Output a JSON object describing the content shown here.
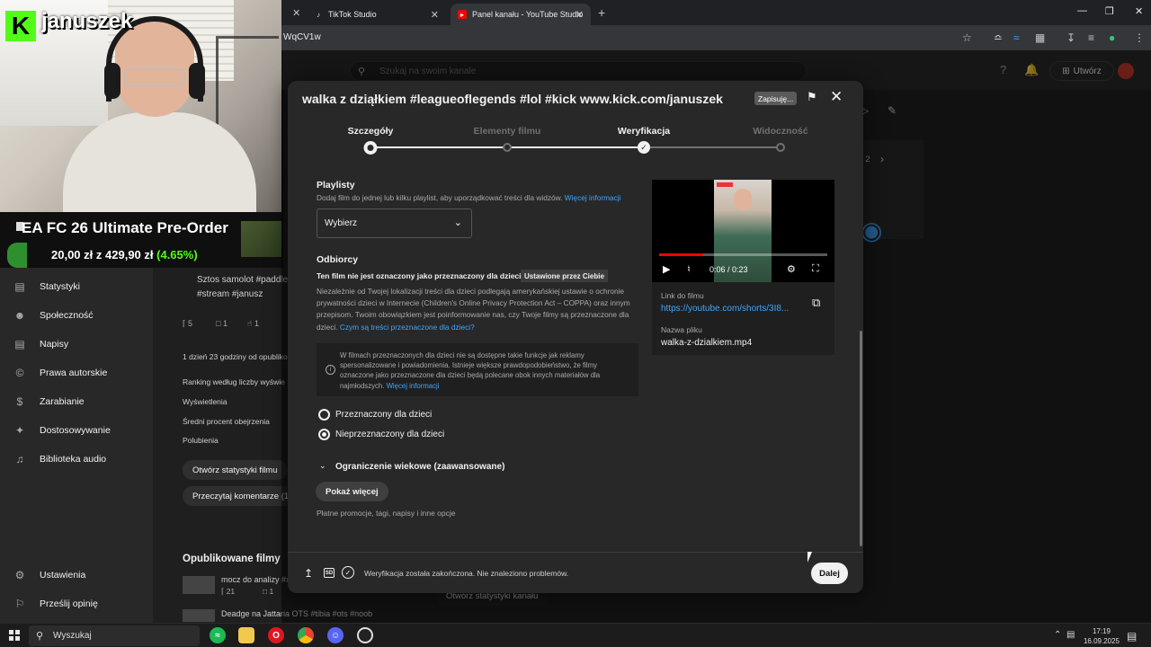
{
  "overlay": {
    "streamer_name": "januszek",
    "promo_title": "EA FC 26 Ultimate Pre-Order",
    "promo_price_a": "20,00 zł",
    "promo_price_z": "z",
    "promo_price_b": "429,90 zł",
    "promo_pct": "(4.65%)"
  },
  "browser": {
    "tabs": [
      {
        "label": "TikTok Studio"
      },
      {
        "label": "Panel kanału - YouTube Studio"
      }
    ],
    "url": "WqCV1w"
  },
  "studio": {
    "search_placeholder": "Szukaj na swoim kanale",
    "create_label": "Utwórz",
    "sidebar": [
      {
        "label": "Statystyki",
        "icon": "chart-icon"
      },
      {
        "label": "Społeczność",
        "icon": "community-icon"
      },
      {
        "label": "Napisy",
        "icon": "subtitles-icon"
      },
      {
        "label": "Prawa autorskie",
        "icon": "copyright-icon"
      },
      {
        "label": "Zarabianie",
        "icon": "dollar-icon"
      },
      {
        "label": "Dostosowywanie",
        "icon": "magic-icon"
      },
      {
        "label": "Biblioteka audio",
        "icon": "audio-library-icon"
      },
      {
        "label": "Ustawienia",
        "icon": "gear-icon"
      },
      {
        "label": "Prześlij opinię",
        "icon": "feedback-icon"
      }
    ],
    "content": {
      "video_title_1": "Sztos samolot #paddle",
      "video_title_2": "#stream #janusz",
      "stat_views": "5",
      "stat_comments": "1",
      "stat_likes": "1",
      "timestamp": "1 dzień 23 godziny od opubliko",
      "ranking": "Ranking według liczby wyświe",
      "views_label": "Wyświetlenia",
      "avg_pct": "Średni procent obejrzenia",
      "likes_label": "Polubienia",
      "btn_stats": "Otwórz statystyki filmu",
      "btn_comments": "Przeczytaj komentarze (1",
      "published_heading": "Opublikowane filmy",
      "pub_1": "mocz do analizy #x",
      "pub_1_views": "21",
      "pub_1_comments": "1",
      "pub_2": "Deadge na Jattaria OTS #tibia #ots #noob",
      "btn_channel_stats": "Otwórz statystyki kanału",
      "page_indicator": "2 / 2"
    }
  },
  "dialog": {
    "title": "walka z dziąłkiem #leagueoflegends #lol #kick www.kick.com/januszek",
    "saving": "Zapisuję...",
    "steps": [
      {
        "label": "Szczegóły",
        "state": "current"
      },
      {
        "label": "Elementy filmu",
        "state": "pending"
      },
      {
        "label": "Weryfikacja",
        "state": "done"
      },
      {
        "label": "Widoczność",
        "state": "pending"
      }
    ],
    "playlists": {
      "heading": "Playlisty",
      "desc": "Dodaj film do jednej lub kilku playlist, aby uporządkować treści dla widzów.",
      "link": "Więcej informacji",
      "select_value": "Wybierz"
    },
    "audience": {
      "heading": "Odbiorcy",
      "bold": "Ten film nie jest oznaczony jako przeznaczony dla dzieci",
      "badge": "Ustawione przez Ciebie",
      "desc": "Niezależnie od Twojej lokalizacji treści dla dzieci podlegają amerykańskiej ustawie o ochronie prywatności dzieci w Internecie (Children's Online Privacy Protection Act – COPPA) oraz innym przepisom. Twoim obowiązkiem jest poinformowanie nas, czy Twoje filmy są przeznaczone dla dzieci.",
      "desc_link": "Czym są treści przeznaczone dla dzieci?",
      "info": "W filmach przeznaczonych dla dzieci nie są dostępne takie funkcje jak reklamy spersonalizowane i powiadomienia. Istnieje większe prawdopodobieństwo, że filmy oznaczone jako przeznaczone dla dzieci będą polecane obok innych materiałów dla najmłodszych.",
      "info_link": "Więcej informacji",
      "option_kids": "Przeznaczony dla dzieci",
      "option_not_kids": "Nieprzeznaczony dla dzieci",
      "selected": "not_kids"
    },
    "age": "Ograniczenie wiekowe (zaawansowane)",
    "show_more": "Pokaż więcej",
    "paid": "Płatne promocje, tagi, napisy i inne opcje",
    "preview": {
      "time": "0:06 / 0:23",
      "progress": 0.26,
      "link_label": "Link do filmu",
      "link_url": "https://youtube.com/shorts/3I8...",
      "file_label": "Nazwa pliku",
      "file_name": "walka-z-dzialkiem.mp4"
    },
    "status": "Weryfikacja została zakończona. Nie znaleziono problemów.",
    "next": "Dalej"
  },
  "taskbar": {
    "search": "Wyszukaj",
    "time": "17:19",
    "date": "16.09.2025"
  }
}
